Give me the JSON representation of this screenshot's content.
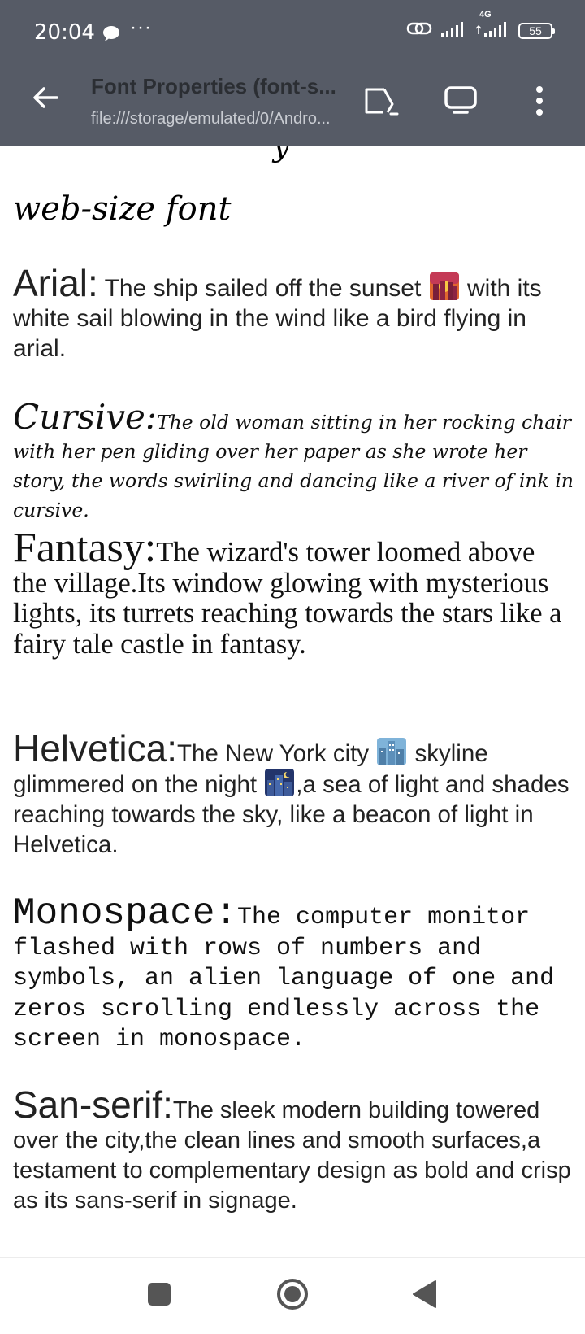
{
  "status_bar": {
    "time": "20:04",
    "network_label": "4G",
    "battery": "55"
  },
  "toolbar": {
    "title": "Font Properties (font-s...",
    "url": "file:///storage/emulated/0/Andro..."
  },
  "content": {
    "clip_remnant": "y",
    "heading": "web-size font",
    "sections": [
      {
        "label": "Arial:",
        "text_before": "The ship sailed off the sunset",
        "emoji": "sunset-emoji",
        "text_after": " with its white sail blowing in the wind like a bird flying in arial."
      },
      {
        "label": "Cursive:",
        "text": "The old woman sitting in her rocking chair with her pen gliding over her paper as she wrote her story, the words swirling and dancing like a river of ink in cursive."
      },
      {
        "label": "Fantasy:",
        "text": "The wizard's tower loomed above the village.Its window glowing with mysterious lights, its turrets reaching towards the stars like a fairy tale castle in fantasy."
      },
      {
        "label": "Helvetica:",
        "text_before": "The New York city",
        "emoji1": "cityscape-emoji",
        "text_middle": " skyline glimmered on the night",
        "emoji2": "night-city-emoji",
        "text_after": ",a sea of light and shades reaching towards the sky, like a beacon of light in Helvetica."
      },
      {
        "label": "Monospace:",
        "text": "The computer monitor flashed with rows of numbers and symbols, an alien language of one and zeros scrolling endlessly across the screen in monospace."
      },
      {
        "label": "San-serif:",
        "text": "The sleek modern building towered over the city,the clean lines and smooth surfaces,a testament to complementary design as bold and crisp as its sans-serif in signage."
      }
    ]
  },
  "icons": {
    "back": "arrow-left-icon",
    "open": "open-in-app-icon",
    "view": "desktop-view-icon",
    "more": "more-vert-icon",
    "nav_recents": "square-icon",
    "nav_home": "circle-icon",
    "nav_back": "triangle-icon"
  },
  "colors": {
    "toolbar_bg": "#565b66",
    "title_text": "#2b2e33",
    "url_text": "#c9ccd2"
  }
}
